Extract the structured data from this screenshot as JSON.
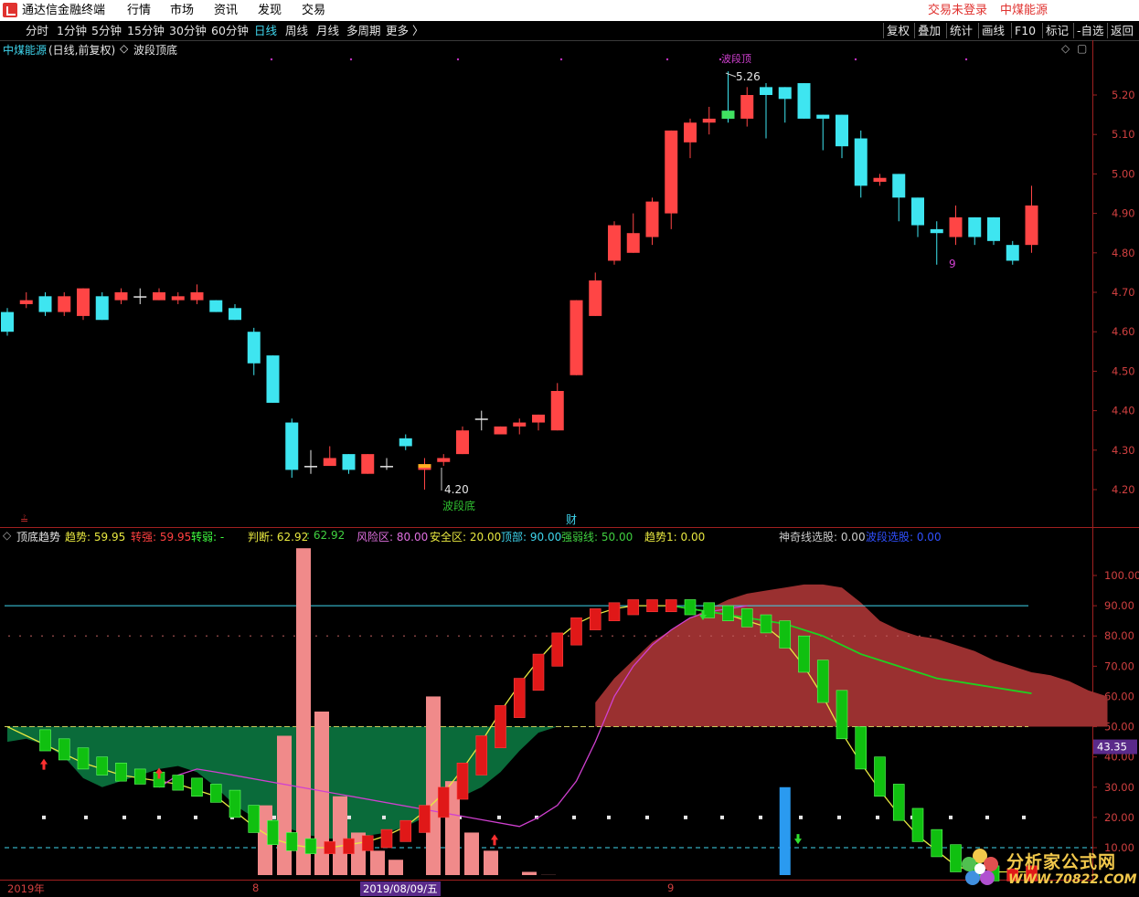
{
  "titlebar": {
    "app": "通达信金融终端",
    "menus": [
      "行情",
      "市场",
      "资讯",
      "发现",
      "交易"
    ],
    "login": "交易未登录",
    "stock": "中煤能源"
  },
  "toolbar": {
    "periods": [
      "分时",
      "1分钟",
      "5分钟",
      "15分钟",
      "30分钟",
      "60分钟",
      "日线",
      "周线",
      "月线",
      "多周期",
      "更多 〉"
    ],
    "selected": "日线",
    "right": [
      "复权",
      "叠加",
      "统计",
      "画线",
      "F10",
      "标记",
      "-自选",
      "返回"
    ]
  },
  "main_header": {
    "name": "中煤能源",
    "info": "(日线,前复权)",
    "indicator": "波段顶底"
  },
  "main_yaxis": [
    "5.20",
    "5.10",
    "5.00",
    "4.90",
    "4.80",
    "4.70",
    "4.60",
    "4.50",
    "4.40",
    "4.30",
    "4.20"
  ],
  "annotations": {
    "high": "5.26",
    "low": "4.20",
    "bottom": "波段底",
    "top": "波段顶",
    "nine": "9",
    "cai": "财"
  },
  "sub_header": {
    "name": "顶底趋势",
    "items": [
      {
        "label": "趋势:",
        "value": "59.95",
        "color": "#e8e840"
      },
      {
        "label": "转强:",
        "value": "59.95",
        "color": "#ff4040"
      },
      {
        "label": "转弱:",
        "value": "-",
        "color": "#40ff40"
      },
      {
        "label": "判断:",
        "value": "62.92",
        "color": "#e8e840"
      },
      {
        "label": ":",
        "value": "62.92",
        "color": "#40d040"
      },
      {
        "label": "风险区:",
        "value": "80.00",
        "color": "#e070e0"
      },
      {
        "label": "安全区:",
        "value": "20.00",
        "color": "#e8e840"
      },
      {
        "label": "顶部:",
        "value": "90.00",
        "color": "#3fd6ee"
      },
      {
        "label": "强弱线:",
        "value": "50.00",
        "color": "#40d040"
      },
      {
        "label": "趋势1:",
        "value": "0.00",
        "color": "#e8e840"
      },
      {
        "label": "神奇线选股:",
        "value": "0.00",
        "color": "#cccccc"
      },
      {
        "label": "波段选股:",
        "value": "0.00",
        "color": "#3050ff"
      }
    ]
  },
  "sub_yaxis": [
    "100.00",
    "90.00",
    "80.00",
    "70.00",
    "60.00",
    "50.00",
    "40.00",
    "30.00",
    "20.00",
    "10.00"
  ],
  "sub_current": "43.35",
  "bottom_axis": {
    "start": "2019年",
    "m8": "8",
    "cursor": "2019/08/09/五",
    "m9": "9"
  },
  "watermark": {
    "title": "分析家公式网",
    "url": "WWW.70822.COM"
  },
  "chart_data": {
    "type": "candlestick",
    "ylim": [
      4.15,
      5.3
    ],
    "candles": [
      [
        4.65,
        4.6,
        4.66,
        4.59
      ],
      [
        4.67,
        4.68,
        4.7,
        4.66
      ],
      [
        4.69,
        4.65,
        4.7,
        4.64
      ],
      [
        4.65,
        4.69,
        4.7,
        4.64
      ],
      [
        4.64,
        4.71,
        4.71,
        4.63
      ],
      [
        4.69,
        4.63,
        4.7,
        4.63
      ],
      [
        4.68,
        4.7,
        4.71,
        4.67
      ],
      [
        4.69,
        4.69,
        4.71,
        4.67
      ],
      [
        4.68,
        4.7,
        4.71,
        4.68
      ],
      [
        4.68,
        4.69,
        4.7,
        4.67
      ],
      [
        4.68,
        4.7,
        4.72,
        4.67
      ],
      [
        4.68,
        4.65,
        4.68,
        4.65
      ],
      [
        4.66,
        4.63,
        4.67,
        4.63
      ],
      [
        4.6,
        4.52,
        4.61,
        4.49
      ],
      [
        4.54,
        4.42,
        4.54,
        4.42
      ],
      [
        4.37,
        4.25,
        4.38,
        4.23
      ],
      [
        4.26,
        4.26,
        4.3,
        4.24
      ],
      [
        4.26,
        4.28,
        4.31,
        4.27
      ],
      [
        4.29,
        4.25,
        4.29,
        4.24
      ],
      [
        4.24,
        4.29,
        4.29,
        4.24
      ],
      [
        4.26,
        4.26,
        4.28,
        4.25
      ],
      [
        4.33,
        4.31,
        4.34,
        4.3
      ],
      [
        4.25,
        4.26,
        4.28,
        4.2
      ],
      [
        4.27,
        4.28,
        4.29,
        4.26
      ],
      [
        4.29,
        4.35,
        4.36,
        4.29
      ],
      [
        4.38,
        4.38,
        4.4,
        4.35
      ],
      [
        4.34,
        4.36,
        4.36,
        4.34
      ],
      [
        4.36,
        4.37,
        4.38,
        4.34
      ],
      [
        4.37,
        4.39,
        4.39,
        4.35
      ],
      [
        4.35,
        4.45,
        4.47,
        4.35
      ],
      [
        4.49,
        4.68,
        4.68,
        4.49
      ],
      [
        4.64,
        4.73,
        4.75,
        4.64
      ],
      [
        4.78,
        4.87,
        4.88,
        4.77
      ],
      [
        4.8,
        4.85,
        4.9,
        4.8
      ],
      [
        4.84,
        4.93,
        4.94,
        4.82
      ],
      [
        4.9,
        5.11,
        5.11,
        4.86
      ],
      [
        5.08,
        5.13,
        5.14,
        5.04
      ],
      [
        5.13,
        5.14,
        5.17,
        5.1
      ],
      [
        5.16,
        5.14,
        5.26,
        5.13
      ],
      [
        5.14,
        5.2,
        5.22,
        5.12
      ],
      [
        5.22,
        5.2,
        5.23,
        5.09
      ],
      [
        5.22,
        5.19,
        5.22,
        5.13
      ],
      [
        5.23,
        5.14,
        5.23,
        5.14
      ],
      [
        5.15,
        5.14,
        5.15,
        5.06
      ],
      [
        5.15,
        5.07,
        5.15,
        5.04
      ],
      [
        5.09,
        4.97,
        5.11,
        4.94
      ],
      [
        4.98,
        4.99,
        5.0,
        4.97
      ],
      [
        5.0,
        4.94,
        5.0,
        4.88
      ],
      [
        4.94,
        4.87,
        4.94,
        4.84
      ],
      [
        4.86,
        4.85,
        4.88,
        4.77
      ],
      [
        4.84,
        4.89,
        4.92,
        4.82
      ],
      [
        4.89,
        4.84,
        4.89,
        4.82
      ],
      [
        4.89,
        4.83,
        4.89,
        4.82
      ],
      [
        4.82,
        4.78,
        4.83,
        4.77
      ],
      [
        4.82,
        4.92,
        4.97,
        4.8
      ]
    ],
    "oscillator": {
      "trend_yellow": [
        50,
        47,
        44,
        41,
        38,
        36,
        34,
        33,
        32,
        31,
        29,
        27,
        22,
        17,
        13,
        11,
        10,
        10,
        11,
        12,
        14,
        17,
        22,
        28,
        36,
        45,
        55,
        64,
        72,
        79,
        84,
        87,
        89,
        90,
        90,
        90,
        89,
        88,
        87,
        85,
        83,
        78,
        70,
        60,
        48,
        38,
        29,
        21,
        14,
        9,
        4,
        2,
        1,
        1,
        2
      ],
      "green_line": [
        90,
        89,
        88,
        87,
        86,
        85,
        84,
        82,
        80,
        77,
        74,
        72,
        70,
        68,
        66,
        65,
        64,
        63,
        62,
        61
      ]
    }
  }
}
